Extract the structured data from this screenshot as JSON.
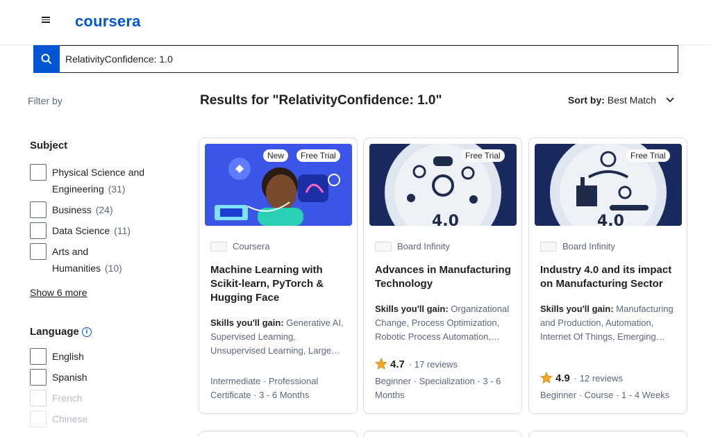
{
  "header": {
    "logo_text": "coursera",
    "menu_icon": "hamburger-icon"
  },
  "search": {
    "value": "RelativityConfidence: 1.0",
    "icon": "search-icon"
  },
  "filter_by_label": "Filter by",
  "results_title": "Results for \"RelativityConfidence: 1.0\"",
  "sort": {
    "label": "Sort by:",
    "value": "Best Match",
    "icon": "chevron-down-icon"
  },
  "subject": {
    "title": "Subject",
    "options": [
      {
        "label_line1": "Physical Science and",
        "label_line2": "Engineering",
        "count": "(31)"
      },
      {
        "label_line1": "Business",
        "count": "(24)"
      },
      {
        "label_line1": "Data Science",
        "count": "(11)"
      },
      {
        "label_line1": "Arts and",
        "label_line2": "Humanities",
        "count": "(10)"
      }
    ],
    "show_more": "Show 6 more"
  },
  "language": {
    "title": "Language",
    "info_icon": "info-icon",
    "options": [
      {
        "label": "English",
        "count": ""
      },
      {
        "label": "Spanish",
        "count": ""
      },
      {
        "label": "French",
        "count": ""
      },
      {
        "label": "Chinese",
        "count": ""
      }
    ]
  },
  "cards": [
    {
      "tags": [
        "New",
        "Free Trial"
      ],
      "partner": "Coursera",
      "title_line1": "Machine Learning with",
      "title_line2": "Scikit-learn, PyTorch &",
      "title_line3": "Hugging Face",
      "skills_label": "Skills you'll gain:",
      "skills": "Generative AI, Supervised Learning, Unsupervised Learning, Large…",
      "meta": "Intermediate · Professional Certificate · 3 - 6 Months",
      "image_colors": {
        "bg": "#3b55e6",
        "accent": "#5f7bff"
      }
    },
    {
      "tags": [
        "Free Trial"
      ],
      "partner": "Board Infinity",
      "title_line1": "Advances in Manufacturing",
      "title_line2": "Technology",
      "skills_label": "Skills you'll gain:",
      "skills": "Organizational Change, Process Optimization, Robotic Process Automation,…",
      "rating": "4.7",
      "reviews": "· 17 reviews",
      "meta": "Beginner · Specialization · 3 - 6 Months",
      "image_colors": {
        "bg": "#1a2a5e",
        "accent": "#dfe6f0"
      }
    },
    {
      "tags": [
        "Free Trial"
      ],
      "partner": "Board Infinity",
      "title_line1": "Industry 4.0 and its impact",
      "title_line2": "on Manufacturing Sector",
      "skills_label": "Skills you'll gain:",
      "skills": "Manufacturing and Production, Automation, Internet Of Things, Emerging…",
      "rating": "4.9",
      "reviews": "· 12 reviews",
      "meta": "Beginner · Course · 1 - 4 Weeks",
      "image_colors": {
        "bg": "#1a2a5e",
        "accent": "#dfe6f0"
      }
    }
  ],
  "colors": {
    "brand": "#0056d2",
    "star": "#f5a623",
    "muted": "#5b6780"
  }
}
